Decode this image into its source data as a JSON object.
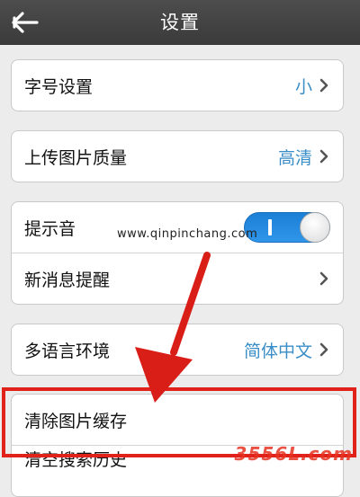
{
  "header": {
    "title": "设置"
  },
  "settings": {
    "font_size": {
      "label": "字号设置",
      "value": "小"
    },
    "upload_quality": {
      "label": "上传图片质量",
      "value": "高清"
    },
    "notification_sound": {
      "label": "提示音",
      "enabled": true
    },
    "new_message_alert": {
      "label": "新消息提醒"
    },
    "language": {
      "label": "多语言环境",
      "value": "简体中文"
    },
    "clear_image_cache": {
      "label": "清除图片缓存"
    },
    "clear_search_history": {
      "label": "清空搜索历史"
    }
  },
  "overlay": {
    "watermark": "www.qinpinchang.com",
    "logo": "3556L.com",
    "highlight_color": "#e1221b"
  },
  "colors": {
    "header_bg": "#444444",
    "value_text": "#3a8ec8",
    "toggle_on": "#2f96ea"
  }
}
